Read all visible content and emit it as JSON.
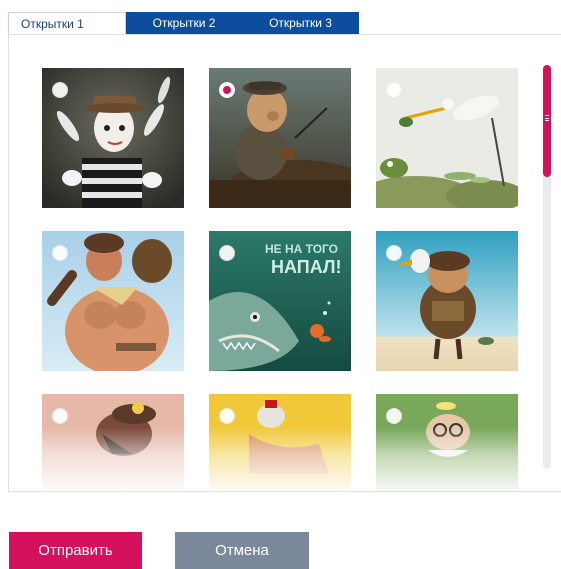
{
  "tabs": [
    {
      "label": "Открытки 1",
      "active": true
    },
    {
      "label": "Открытки 2",
      "active": false
    },
    {
      "label": "Открытки 3",
      "active": false
    }
  ],
  "cards": [
    {
      "subject": "mime juggler",
      "selected": false
    },
    {
      "subject": "old man on cart",
      "selected": true
    },
    {
      "subject": "frog and stork",
      "selected": false
    },
    {
      "subject": "strongman",
      "selected": false
    },
    {
      "subject": "fish",
      "text": "НЕ НА ТОГО НАПАЛ!",
      "selected": false
    },
    {
      "subject": "pilot with bird",
      "selected": false
    },
    {
      "subject": "hat character",
      "selected": false
    },
    {
      "subject": "yellow character",
      "selected": false
    },
    {
      "subject": "scientist",
      "selected": false
    }
  ],
  "buttons": {
    "submit": "Отправить",
    "cancel": "Отмена"
  },
  "colors": {
    "accent": "#d4115a",
    "tab_bg": "#0d4d9e",
    "cancel_bg": "#7a8899"
  }
}
